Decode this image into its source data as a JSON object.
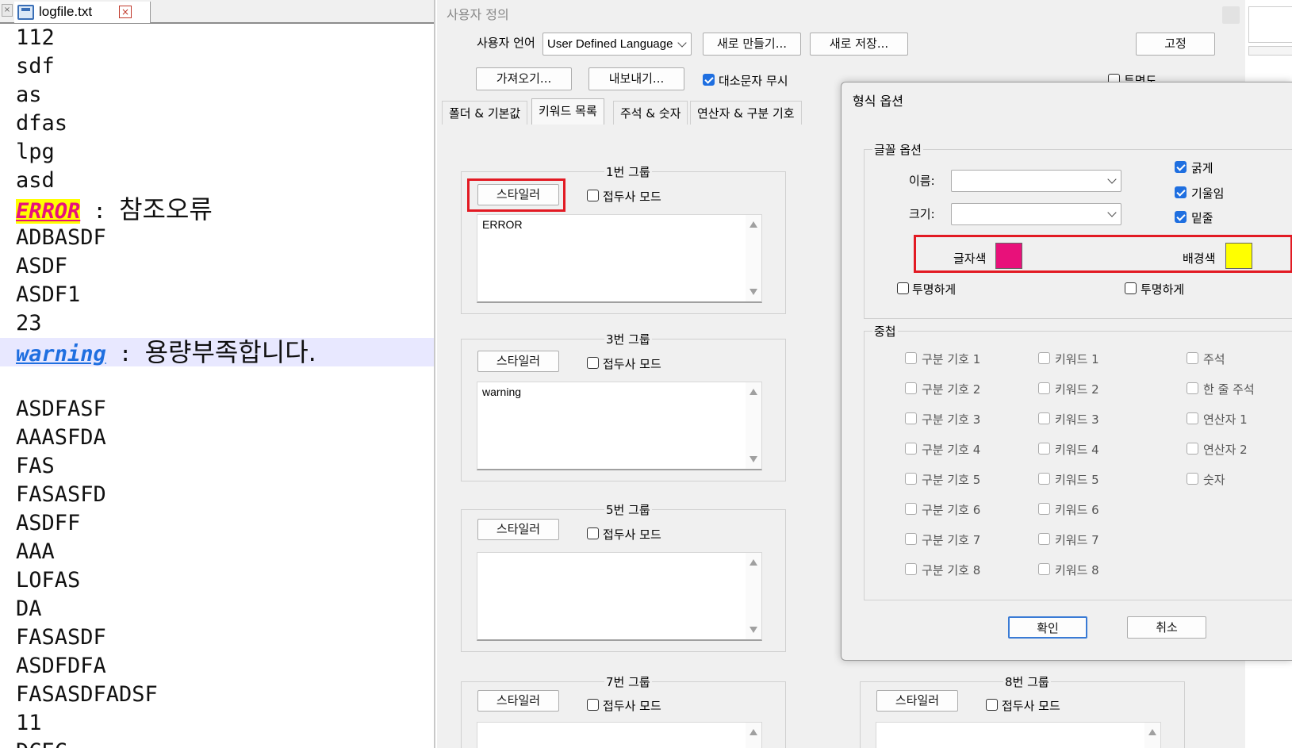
{
  "editor": {
    "tab_name": "logfile.txt",
    "lines": [
      "112",
      "sdf",
      "as",
      "dfas",
      "lpg",
      "asd"
    ],
    "error_keyword": "ERROR",
    "error_rest_sep": " : ",
    "error_msg": "참조오류",
    "lines2": [
      "ADBASDF",
      "ASDF",
      "ASDF1",
      "23"
    ],
    "warning_keyword": "warning",
    "warning_sep": " : ",
    "warning_msg": "용량부족합니다.",
    "lines3": [
      "",
      "ASDFASF",
      "AAASFDA",
      "FAS",
      "FASASFD",
      "ASDFF",
      "AAA",
      "LOFAS",
      "DA",
      "FASASDF",
      "ASDFDFA",
      "FASASDFADSF",
      "11",
      "DCEC"
    ]
  },
  "udl": {
    "title": "사용자 정의",
    "lang_label": "사용자 언어",
    "lang_value": "User Defined Language",
    "new_btn": "새로 만들기...",
    "save_as_btn": "새로 저장...",
    "dock_btn": "고정",
    "import_btn": "가져오기...",
    "export_btn": "내보내기...",
    "ignore_case": "대소문자 무시",
    "transparency": "투명도",
    "tabs": [
      "폴더 & 기본값",
      "키워드 목록",
      "주석 & 숫자",
      "연산자 & 구분 기호"
    ],
    "styler_btn": "스타일러",
    "prefix_mode": "접두사 모드",
    "groups": [
      {
        "title": "1번 그룹",
        "text": "ERROR"
      },
      {
        "title": "3번 그룹",
        "text": "warning"
      },
      {
        "title": "5번 그룹",
        "text": ""
      },
      {
        "title": "7번 그룹",
        "text": ""
      },
      {
        "title": "8번 그룹",
        "text": ""
      }
    ]
  },
  "fmt": {
    "title": "형식 옵션",
    "font_section": "글꼴 옵션",
    "name_label": "이름:",
    "size_label": "크기:",
    "bold": "굵게",
    "italic": "기울임",
    "underline": "밑줄",
    "fg_label": "글자색",
    "bg_label": "배경색",
    "fg_color": "#e8117a",
    "bg_color": "#ffff00",
    "transparent": "투명하게",
    "nesting_section": "중첩",
    "col1": [
      "구분 기호 1",
      "구분 기호 2",
      "구분 기호 3",
      "구분 기호 4",
      "구분 기호 5",
      "구분 기호 6",
      "구분 기호 7",
      "구분 기호 8"
    ],
    "col2": [
      "키워드 1",
      "키워드 2",
      "키워드 3",
      "키워드 4",
      "키워드 5",
      "키워드 6",
      "키워드 7",
      "키워드 8"
    ],
    "col3": [
      "주석",
      "한 줄 주석",
      "연산자 1",
      "연산자 2",
      "숫자"
    ],
    "ok_btn": "확인",
    "cancel_btn": "취소"
  }
}
